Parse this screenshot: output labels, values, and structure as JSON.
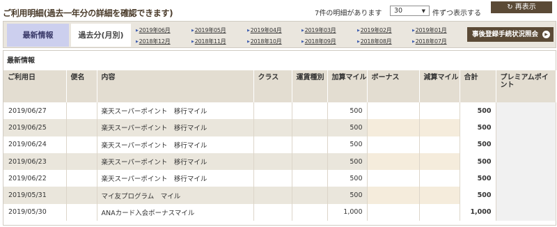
{
  "header": {
    "title": "ご利用明細(過去一年分の詳細を確認できます)",
    "count_text": "7件の明細があります",
    "per_page_value": "30",
    "per_page_suffix": "件ずつ表示する",
    "refresh_label": "再表示"
  },
  "tabs": {
    "latest_label": "最新情報",
    "past_label": "過去分(月別)"
  },
  "months": [
    [
      "2019年06月",
      "2018年12月"
    ],
    [
      "2019年05月",
      "2018年11月"
    ],
    [
      "2019年04月",
      "2018年10月"
    ],
    [
      "2019年03月",
      "2018年09月"
    ],
    [
      "2019年02月",
      "2018年08月"
    ],
    [
      "2019年01月",
      "2018年07月"
    ]
  ],
  "status_inquiry_label": "事後登録手続状況照会",
  "section_label": "最新情報",
  "columns": [
    "ご利用日",
    "便名",
    "内容",
    "クラス",
    "運賃種別",
    "加算マイル",
    "ボーナス",
    "減算マイル",
    "合計",
    "プレミアムポイント"
  ],
  "rows": [
    {
      "date": "2019/06/27",
      "flight": "",
      "content": "楽天スーパーポイント　移行マイル",
      "class": "",
      "fare": "",
      "added": "500",
      "bonus": "",
      "deducted": "",
      "total": "500",
      "premium": ""
    },
    {
      "date": "2019/06/25",
      "flight": "",
      "content": "楽天スーパーポイント　移行マイル",
      "class": "",
      "fare": "",
      "added": "500",
      "bonus": "",
      "deducted": "",
      "total": "500",
      "premium": ""
    },
    {
      "date": "2019/06/24",
      "flight": "",
      "content": "楽天スーパーポイント　移行マイル",
      "class": "",
      "fare": "",
      "added": "500",
      "bonus": "",
      "deducted": "",
      "total": "500",
      "premium": ""
    },
    {
      "date": "2019/06/23",
      "flight": "",
      "content": "楽天スーパーポイント　移行マイル",
      "class": "",
      "fare": "",
      "added": "500",
      "bonus": "",
      "deducted": "",
      "total": "500",
      "premium": ""
    },
    {
      "date": "2019/06/22",
      "flight": "",
      "content": "楽天スーパーポイント　移行マイル",
      "class": "",
      "fare": "",
      "added": "500",
      "bonus": "",
      "deducted": "",
      "total": "500",
      "premium": ""
    },
    {
      "date": "2019/05/31",
      "flight": "",
      "content": "マイ友プログラム　マイル",
      "class": "",
      "fare": "",
      "added": "500",
      "bonus": "",
      "deducted": "",
      "total": "500",
      "premium": ""
    },
    {
      "date": "2019/05/30",
      "flight": "",
      "content": "ANAカード入会ボーナスマイル",
      "class": "",
      "fare": "",
      "added": "1,000",
      "bonus": "",
      "deducted": "",
      "total": "1,000",
      "premium": ""
    }
  ],
  "colors": {
    "brand_brown": "#5b4a36",
    "active_tab": "#cccfee",
    "header_row": "#e3ddd1",
    "stripe_row": "#eae6dc"
  }
}
